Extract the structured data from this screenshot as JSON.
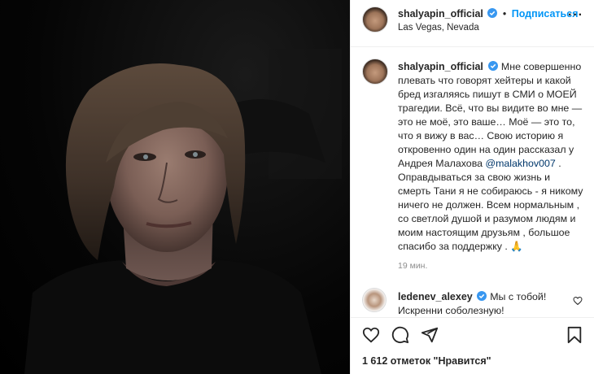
{
  "post": {
    "username": "shalyapin_official",
    "follow_label": "Подписаться",
    "location": "Las Vegas, Nevada",
    "caption": "Мне совершенно плевать что говорят хейтеры и какой бред изгаляясь пишут в СМИ о МОЕЙ трагедии. Всё, что вы видите во мне — это не моё, это ваше… Моё — это то, что я вижу в вас… Свою историю я откровенно один на один рассказал у Андрея Малахова",
    "mention": "@malakhov007",
    "caption_after": ". Оправдываться за свою жизнь и смерть Тани я не собираюсь - я никому ничего не должен. Всем нормальным , со светлой душой и разумом людям и моим настоящим друзьям , большое спасибо за поддержку .",
    "caption_emoji": "🙏",
    "time": "19 мин.",
    "likes": "1 612 отметок \"Нравится\""
  },
  "comment": {
    "username": "ledenev_alexey",
    "text": "Мы с тобой! Искренни соболезную!"
  },
  "icons": [
    "verified-badge-icon",
    "more-options-icon",
    "heart-icon",
    "comment-icon",
    "share-icon",
    "bookmark-icon",
    "small-heart-icon"
  ],
  "colors": {
    "accent": "#0095f6",
    "text": "#262626",
    "muted": "#8e8e8e",
    "mention": "#00376b",
    "border": "#efefef"
  }
}
